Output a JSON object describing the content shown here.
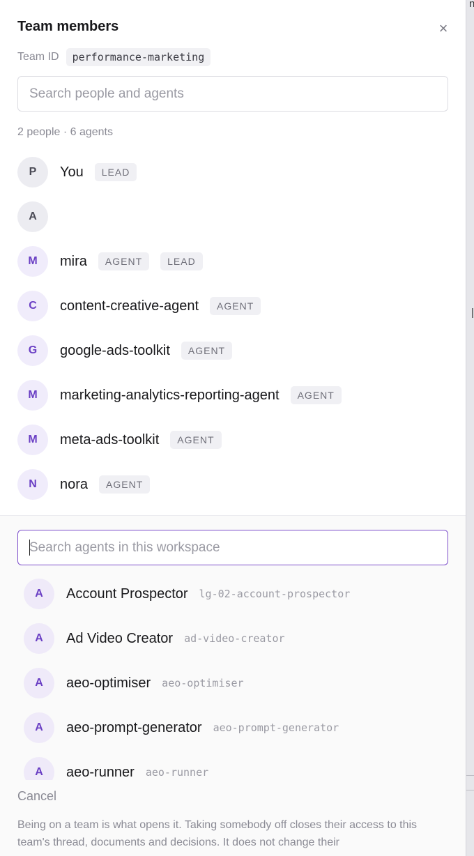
{
  "dialog": {
    "title": "Team members",
    "close_icon": "×",
    "team_id_label": "Team ID",
    "team_id_value": "performance-marketing"
  },
  "search": {
    "placeholder": "Search people and agents",
    "value": ""
  },
  "counts": "2 people · 6 agents",
  "members": [
    {
      "initial": "P",
      "name": "You",
      "kind": "person",
      "tags": [
        "LEAD"
      ]
    },
    {
      "initial": "A",
      "name": "",
      "kind": "person",
      "tags": []
    },
    {
      "initial": "M",
      "name": "mira",
      "kind": "agent",
      "tags": [
        "AGENT",
        "LEAD"
      ]
    },
    {
      "initial": "C",
      "name": "content-creative-agent",
      "kind": "agent",
      "tags": [
        "AGENT"
      ]
    },
    {
      "initial": "G",
      "name": "google-ads-toolkit",
      "kind": "agent",
      "tags": [
        "AGENT"
      ]
    },
    {
      "initial": "M",
      "name": "marketing-analytics-reporting-agent",
      "kind": "agent",
      "tags": [
        "AGENT"
      ]
    },
    {
      "initial": "M",
      "name": "meta-ads-toolkit",
      "kind": "agent",
      "tags": [
        "AGENT"
      ]
    },
    {
      "initial": "N",
      "name": "nora",
      "kind": "agent",
      "tags": [
        "AGENT"
      ]
    }
  ],
  "agent_search": {
    "placeholder": "Search agents in this workspace",
    "value": ""
  },
  "workspace_agents": [
    {
      "initial": "A",
      "name": "Account Prospector",
      "slug": "lg-02-account-prospector"
    },
    {
      "initial": "A",
      "name": "Ad Video Creator",
      "slug": "ad-video-creator"
    },
    {
      "initial": "A",
      "name": "aeo-optimiser",
      "slug": "aeo-optimiser"
    },
    {
      "initial": "A",
      "name": "aeo-prompt-generator",
      "slug": "aeo-prompt-generator"
    },
    {
      "initial": "A",
      "name": "aeo-runner",
      "slug": "aeo-runner"
    }
  ],
  "cancel_label": "Cancel",
  "footer_note": "Being on a team is what opens it. Taking somebody off closes their access to this team's thread, documents and decisions. It does not change their",
  "colors": {
    "accent": "#7c4dca",
    "agent_avatar_bg": "#f0ecfb",
    "agent_avatar_text": "#6a3fc4",
    "tag_bg": "#f0f0f4"
  }
}
